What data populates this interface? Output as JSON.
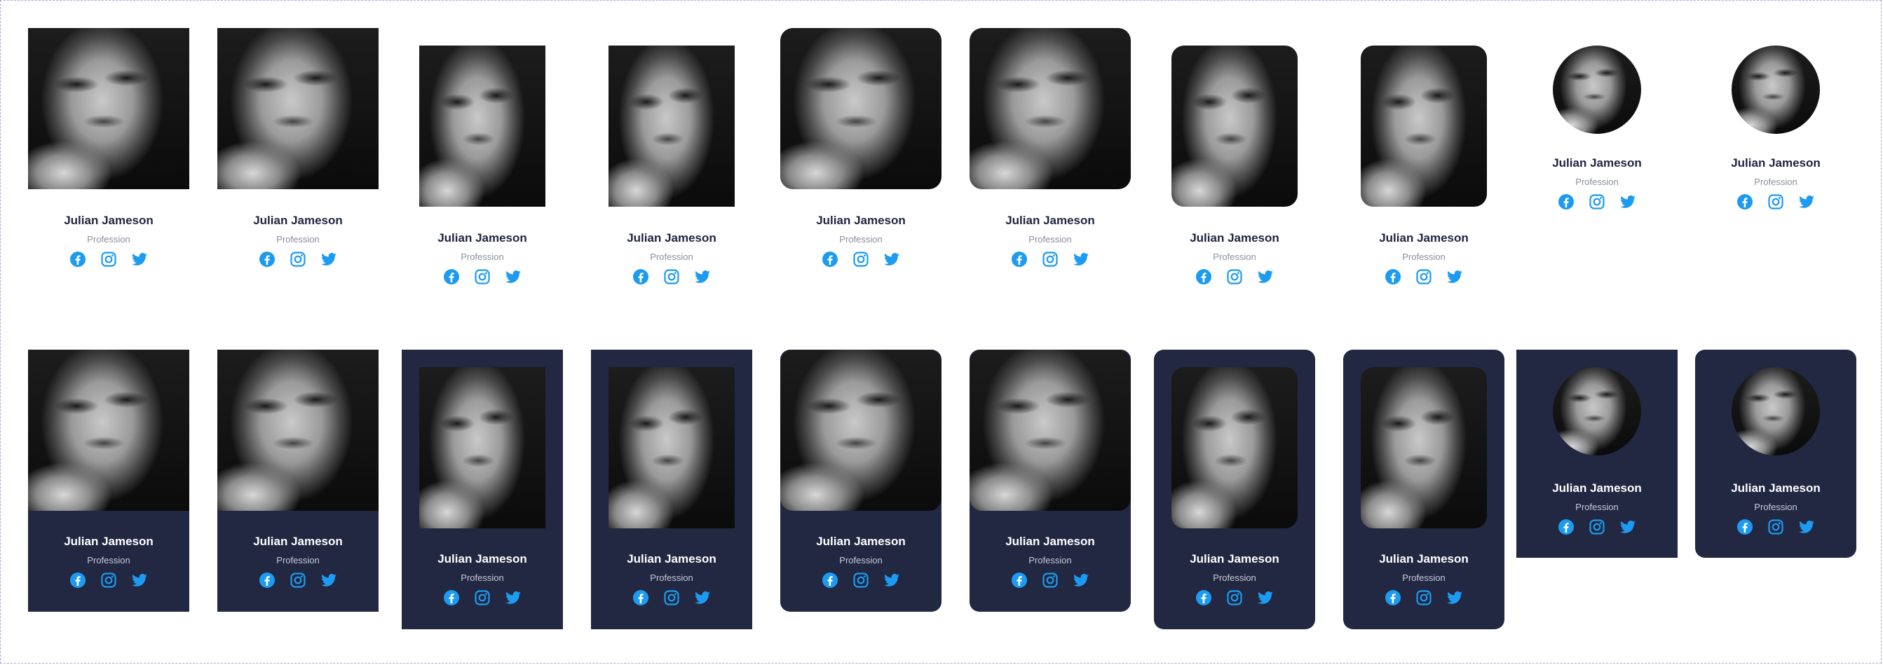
{
  "member": {
    "name": "Julian Jameson",
    "profession": "Profession"
  },
  "icons": [
    "facebook-icon",
    "instagram-icon",
    "twitter-icon"
  ],
  "colors": {
    "accent": "#1d9bf0",
    "dark_card": "#222742",
    "frame_border": "#a9a3e8"
  },
  "cards": [
    {
      "style": "light",
      "photo": "square"
    },
    {
      "style": "light",
      "photo": "square"
    },
    {
      "style": "light",
      "photo": "square-inset"
    },
    {
      "style": "light",
      "photo": "square-inset"
    },
    {
      "style": "light",
      "photo": "rounded"
    },
    {
      "style": "light",
      "photo": "rounded"
    },
    {
      "style": "light",
      "photo": "rounded-inset"
    },
    {
      "style": "light",
      "photo": "rounded-inset"
    },
    {
      "style": "light",
      "photo": "circle"
    },
    {
      "style": "light",
      "photo": "circle"
    },
    {
      "style": "dark",
      "photo": "square"
    },
    {
      "style": "dark",
      "photo": "square"
    },
    {
      "style": "dark",
      "photo": "square-inset"
    },
    {
      "style": "dark",
      "photo": "square-inset"
    },
    {
      "style": "dark-rounded",
      "photo": "rounded"
    },
    {
      "style": "dark-rounded",
      "photo": "rounded"
    },
    {
      "style": "dark-rounded",
      "photo": "rounded-inset"
    },
    {
      "style": "dark-rounded",
      "photo": "rounded-inset"
    },
    {
      "style": "dark",
      "photo": "circle"
    },
    {
      "style": "dark-rounded",
      "photo": "circle"
    }
  ]
}
